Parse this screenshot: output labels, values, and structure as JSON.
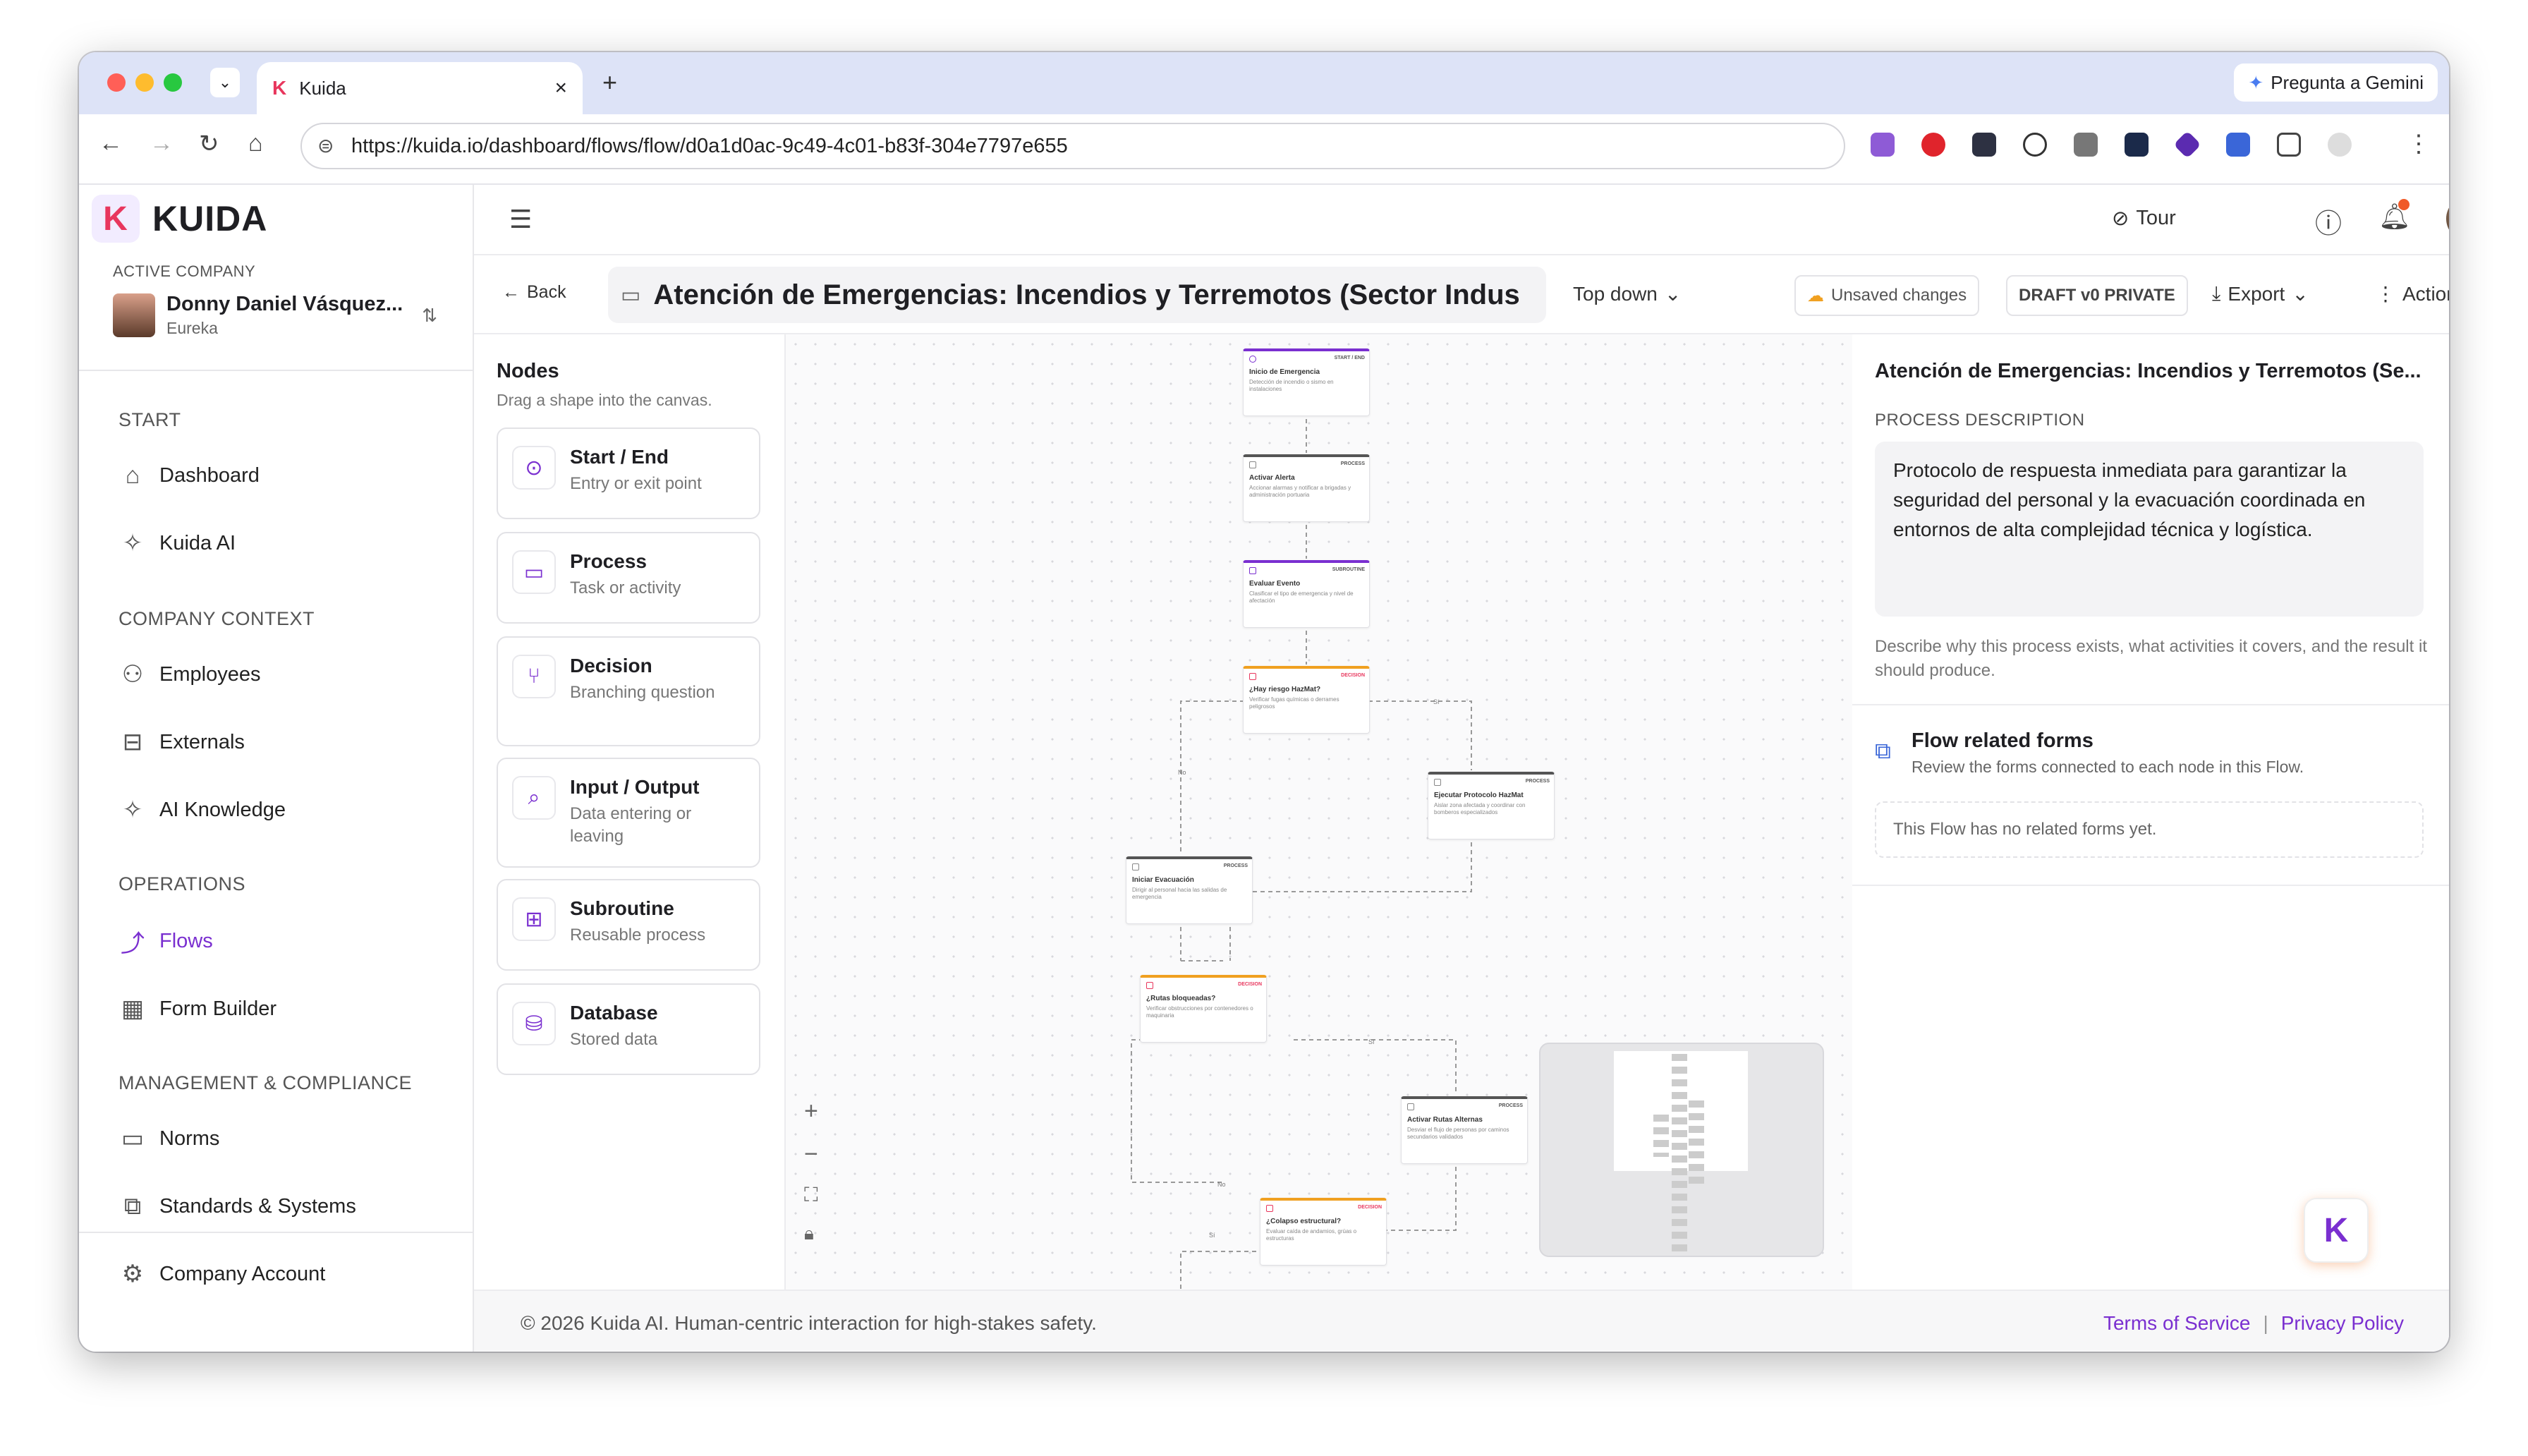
{
  "browser": {
    "tab_title": "Kuida",
    "url": "https://kuida.io/dashboard/flows/flow/d0a1d0ac-9c49-4c01-b83f-304e7797e655",
    "gemini_label": "Pregunta a Gemini"
  },
  "sidebar": {
    "brand": "KUIDA",
    "active_company_label": "ACTIVE COMPANY",
    "user_name": "Donny Daniel Vásquez...",
    "company": "Eureka",
    "sections": [
      {
        "title": "START",
        "items": [
          {
            "label": "Dashboard",
            "icon": "home-icon"
          },
          {
            "label": "Kuida AI",
            "icon": "sparkle-icon"
          }
        ]
      },
      {
        "title": "COMPANY CONTEXT",
        "items": [
          {
            "label": "Employees",
            "icon": "users-icon"
          },
          {
            "label": "Externals",
            "icon": "briefcase-icon"
          },
          {
            "label": "AI Knowledge",
            "icon": "sparkle-icon"
          }
        ]
      },
      {
        "title": "OPERATIONS",
        "items": [
          {
            "label": "Flows",
            "icon": "flow-icon"
          },
          {
            "label": "Form Builder",
            "icon": "grid-icon"
          }
        ]
      },
      {
        "title": "MANAGEMENT & COMPLIANCE",
        "items": [
          {
            "label": "Norms",
            "icon": "book-icon"
          },
          {
            "label": "Standards & Systems",
            "icon": "puzzle-icon"
          }
        ]
      }
    ],
    "company_account": "Company Account"
  },
  "topbar": {
    "tour": "Tour"
  },
  "flowbar": {
    "back": "Back",
    "title": "Atención de Emergencias: Incendios y Terremotos (Sector Indus",
    "layout": "Top down",
    "unsaved": "Unsaved changes",
    "draft": "DRAFT v0 PRIVATE",
    "export": "Export",
    "actions": "Actions"
  },
  "nodes_panel": {
    "title": "Nodes",
    "hint": "Drag a shape into the canvas.",
    "items": [
      {
        "title": "Start / End",
        "sub": "Entry or exit point"
      },
      {
        "title": "Process",
        "sub": "Task or activity"
      },
      {
        "title": "Decision",
        "sub": "Branching question"
      },
      {
        "title": "Input / Output",
        "sub": "Data entering or leaving"
      },
      {
        "title": "Subroutine",
        "sub": "Reusable process"
      },
      {
        "title": "Database",
        "sub": "Stored data"
      }
    ]
  },
  "canvas": {
    "nodes": [
      {
        "title": "Inicio de Emergencia",
        "tag": "START / END",
        "desc": "Detección de incendio o sismo en instalaciones"
      },
      {
        "title": "Activar Alerta",
        "tag": "PROCESS",
        "desc": "Accionar alarmas y notificar a brigadas y administración portuaria"
      },
      {
        "title": "Evaluar Evento",
        "tag": "SUBROUTINE",
        "desc": "Clasificar el tipo de emergencia y nivel de afectación"
      },
      {
        "title": "¿Hay riesgo HazMat?",
        "tag": "DECISION",
        "desc": "Verificar fugas químicas o derrames peligrosos"
      },
      {
        "title": "Ejecutar Protocolo HazMat",
        "tag": "PROCESS",
        "desc": "Aislar zona afectada y coordinar con bomberos especializados"
      },
      {
        "title": "Iniciar Evacuación",
        "tag": "PROCESS",
        "desc": "Dirigir al personal hacia las salidas de emergencia"
      },
      {
        "title": "¿Rutas bloqueadas?",
        "tag": "DECISION",
        "desc": "Verificar obstrucciones por contenedores o maquinaria"
      },
      {
        "title": "Activar Rutas Alternas",
        "tag": "PROCESS",
        "desc": "Desviar el flujo de personas por caminos secundarios validados"
      },
      {
        "title": "¿Colapso estructural?",
        "tag": "DECISION",
        "desc": "Evaluar caída de andamios, grúas o estructuras"
      }
    ],
    "edge_labels": {
      "yes": "Sí",
      "no": "No"
    }
  },
  "right_panel": {
    "title": "Atención de Emergencias: Incendios y Terremotos (Se...",
    "desc_label": "PROCESS DESCRIPTION",
    "desc_value": "Protocolo de respuesta inmediata para garantizar la seguridad del personal y la evacuación coordinada en entornos de alta complejidad técnica y logística.",
    "desc_help": "Describe why this process exists, what activities it covers, and the result it should produce.",
    "forms_title": "Flow related forms",
    "forms_sub": "Review the forms connected to each node in this Flow.",
    "forms_empty": "This Flow has no related forms yet."
  },
  "footer": {
    "copyright": "© 2026 Kuida AI. Human-centric interaction for high-stakes safety.",
    "terms": "Terms of Service",
    "privacy": "Privacy Policy"
  },
  "colors": {
    "accent": "#7a2fd0",
    "brand_k": "#e8365d",
    "decision": "#f0a020"
  }
}
